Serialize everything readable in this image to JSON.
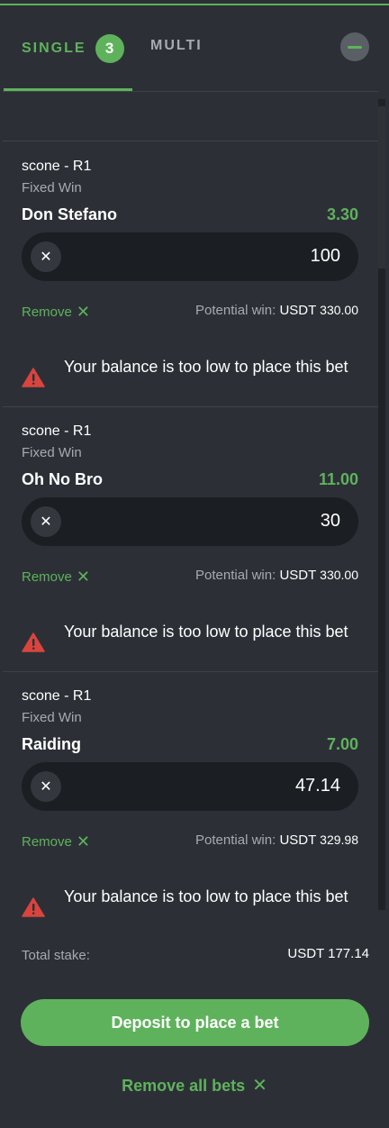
{
  "tabs": {
    "single_label": "SINGLE",
    "single_count": "3",
    "multi_label": "MULTI"
  },
  "bets": [
    {
      "race": "scone - R1",
      "bet_type": "Fixed Win",
      "runner": "Don Stefano",
      "odds": "3.30",
      "stake": "100",
      "remove_label": "Remove",
      "potential_label": "Potential win:",
      "potential_currency": "USDT",
      "potential_value": "330.00",
      "warning": "Your balance is too low to place this bet"
    },
    {
      "race": "scone - R1",
      "bet_type": "Fixed Win",
      "runner": "Oh No Bro",
      "odds": "11.00",
      "stake": "30",
      "remove_label": "Remove",
      "potential_label": "Potential win:",
      "potential_currency": "USDT",
      "potential_value": "330.00",
      "warning": "Your balance is too low to place this bet"
    },
    {
      "race": "scone - R1",
      "bet_type": "Fixed Win",
      "runner": "Raiding",
      "odds": "7.00",
      "stake": "47.14",
      "remove_label": "Remove",
      "potential_label": "Potential win:",
      "potential_currency": "USDT",
      "potential_value": "329.98",
      "warning": "Your balance is too low to place this bet"
    }
  ],
  "summary": {
    "total_label": "Total stake:",
    "total_value": "USDT 177.14",
    "deposit_label": "Deposit to place a bet",
    "remove_all_label": "Remove all bets"
  },
  "colors": {
    "accent": "#5fb25c",
    "background": "#2c3036",
    "warning": "#d9443f"
  }
}
